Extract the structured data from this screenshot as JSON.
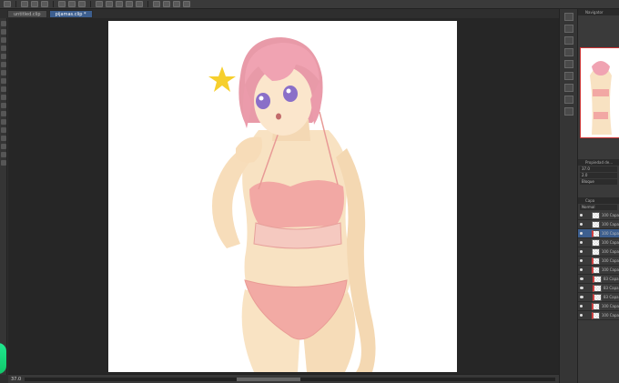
{
  "document_tabs": [
    {
      "label": "untitled.clip",
      "active": false
    },
    {
      "label": "pijamas.clip *",
      "active": true
    }
  ],
  "status": {
    "zoom": "37.0"
  },
  "navigator": {
    "title": "Navigator"
  },
  "tool_property": {
    "title": "Propiedad de...",
    "rows": [
      "37.0",
      "2.0",
      "Bloque"
    ]
  },
  "layers": {
    "title": "Capa",
    "blend_mode": "Normal",
    "items": [
      {
        "opacity": "100",
        "name": "Capa",
        "selected": false,
        "has_red": false
      },
      {
        "opacity": "100",
        "name": "Capa",
        "selected": false,
        "has_red": false
      },
      {
        "opacity": "100",
        "name": "Capa",
        "selected": true,
        "has_red": true
      },
      {
        "opacity": "100",
        "name": "Capa",
        "selected": false,
        "has_red": false
      },
      {
        "opacity": "100",
        "name": "Capa",
        "selected": false,
        "has_red": false
      },
      {
        "opacity": "100",
        "name": "Capa",
        "selected": false,
        "has_red": true
      },
      {
        "opacity": "100",
        "name": "Capa",
        "selected": false,
        "has_red": true
      },
      {
        "opacity": "83",
        "name": "Capa",
        "selected": false,
        "has_red": true
      },
      {
        "opacity": "83",
        "name": "Capa",
        "selected": false,
        "has_red": true
      },
      {
        "opacity": "83",
        "name": "Capa",
        "selected": false,
        "has_red": true
      },
      {
        "opacity": "100",
        "name": "Capa",
        "selected": false,
        "has_red": true
      },
      {
        "opacity": "100",
        "name": "Capa",
        "selected": false,
        "has_red": true
      }
    ]
  },
  "colors": {
    "accent": "#3d5f8f",
    "color_wheel": "#10c86a"
  }
}
